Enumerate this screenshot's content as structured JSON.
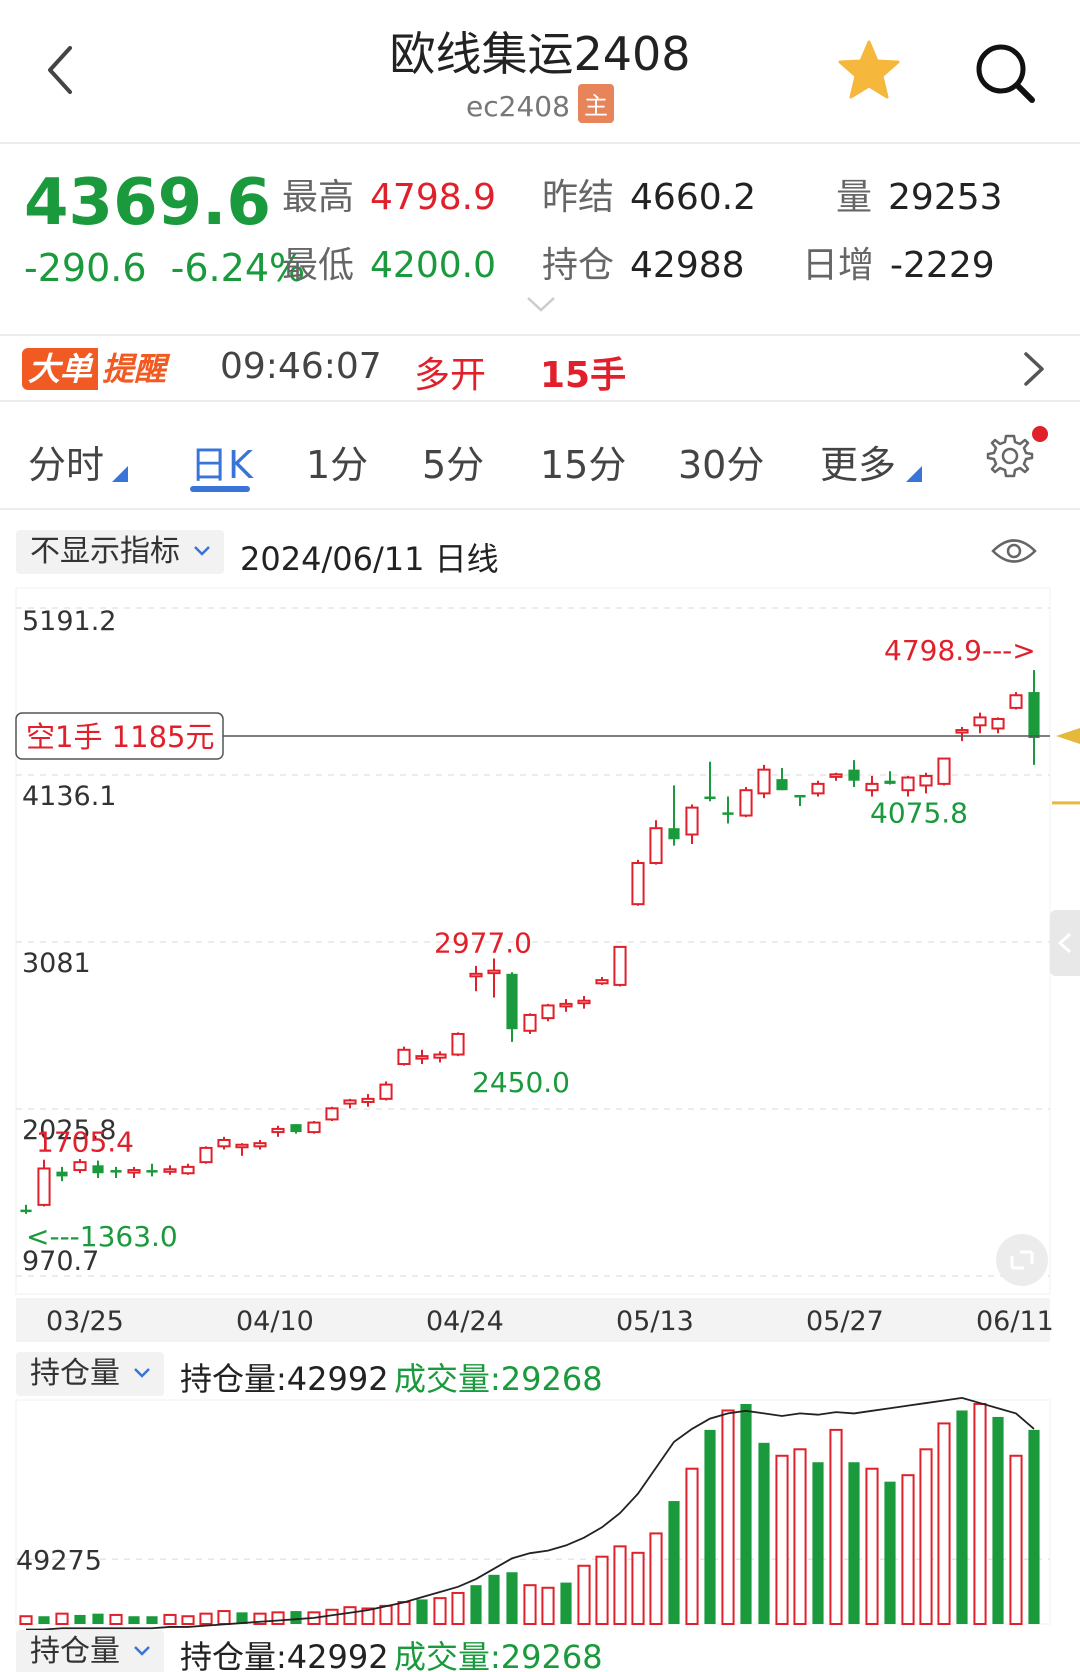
{
  "header": {
    "title": "欧线集运2408",
    "code": "ec2408",
    "badge": "主"
  },
  "quote": {
    "price": "4369.6",
    "change": "-290.6",
    "change_pct": "-6.24%",
    "high_label": "最高",
    "high": "4798.9",
    "low_label": "最低",
    "low": "4200.0",
    "prev_settle_label": "昨结",
    "prev_settle": "4660.2",
    "open_interest_label": "持仓",
    "open_interest": "42988",
    "volume_label": "量",
    "volume": "29253",
    "daily_inc_label": "日增",
    "daily_inc": "-2229"
  },
  "alert": {
    "logo_a": "大单",
    "logo_b": "提醒",
    "time": "09:46:07",
    "action": "多开",
    "lots": "15手"
  },
  "tabs": [
    {
      "label": "分时",
      "active": false
    },
    {
      "label": "日K",
      "active": true
    },
    {
      "label": "1分",
      "active": false
    },
    {
      "label": "5分",
      "active": false
    },
    {
      "label": "15分",
      "active": false
    },
    {
      "label": "30分",
      "active": false
    },
    {
      "label": "更多",
      "active": false
    }
  ],
  "indicator": {
    "select": "不显示指标",
    "date_text": "2024/06/11  日线"
  },
  "volume_panel": {
    "select": "持仓量",
    "oi_text": "持仓量:42992",
    "vol_text": "成交量:29268"
  },
  "colors": {
    "up": "#e0202b",
    "down": "#1a9a3c",
    "accent": "#3a74d8"
  },
  "chart_data": {
    "type": "candlestick",
    "y_ticks": [
      "5191.2",
      "4136.1",
      "3081",
      "2025.8",
      "970.7"
    ],
    "ylim": [
      970.7,
      5191.2
    ],
    "x_ticks": [
      "03/25",
      "04/10",
      "04/24",
      "05/13",
      "05/27",
      "06/11"
    ],
    "position_label": "空1手  1185元",
    "position_price": 4369.6,
    "annotations": [
      {
        "text": "4798.9",
        "price": 4798.9,
        "color": "up",
        "arrow": "right"
      },
      {
        "text": "1705.4",
        "price": 1705.4,
        "color": "up",
        "arrow": "none"
      },
      {
        "text": "1363.0",
        "price": 1363.0,
        "color": "down",
        "arrow": "left"
      },
      {
        "text": "2977.0",
        "price": 2977.0,
        "color": "up",
        "arrow": "none"
      },
      {
        "text": "2450.0",
        "price": 2450.0,
        "color": "down",
        "arrow": "none"
      },
      {
        "text": "4075.8",
        "price": 4075.8,
        "color": "down",
        "arrow": "none"
      }
    ],
    "candles": [
      {
        "o": 1390,
        "h": 1420,
        "l": 1363,
        "c": 1375
      },
      {
        "o": 1420,
        "h": 1705.4,
        "l": 1410,
        "c": 1650
      },
      {
        "o": 1630,
        "h": 1660,
        "l": 1570,
        "c": 1600
      },
      {
        "o": 1640,
        "h": 1710,
        "l": 1620,
        "c": 1690
      },
      {
        "o": 1670,
        "h": 1700,
        "l": 1590,
        "c": 1620
      },
      {
        "o": 1640,
        "h": 1660,
        "l": 1590,
        "c": 1630
      },
      {
        "o": 1625,
        "h": 1660,
        "l": 1590,
        "c": 1640
      },
      {
        "o": 1640,
        "h": 1680,
        "l": 1600,
        "c": 1630
      },
      {
        "o": 1630,
        "h": 1670,
        "l": 1610,
        "c": 1645
      },
      {
        "o": 1620,
        "h": 1680,
        "l": 1610,
        "c": 1660
      },
      {
        "o": 1690,
        "h": 1790,
        "l": 1680,
        "c": 1780
      },
      {
        "o": 1790,
        "h": 1850,
        "l": 1770,
        "c": 1830
      },
      {
        "o": 1800,
        "h": 1810,
        "l": 1730,
        "c": 1800
      },
      {
        "o": 1790,
        "h": 1830,
        "l": 1770,
        "c": 1810
      },
      {
        "o": 1880,
        "h": 1920,
        "l": 1850,
        "c": 1900
      },
      {
        "o": 1930,
        "h": 1930,
        "l": 1870,
        "c": 1880
      },
      {
        "o": 1880,
        "h": 1950,
        "l": 1870,
        "c": 1940
      },
      {
        "o": 1960,
        "h": 2040,
        "l": 1950,
        "c": 2030
      },
      {
        "o": 2060,
        "h": 2090,
        "l": 2030,
        "c": 2080
      },
      {
        "o": 2070,
        "h": 2120,
        "l": 2040,
        "c": 2090
      },
      {
        "o": 2090,
        "h": 2200,
        "l": 2080,
        "c": 2180
      },
      {
        "o": 2310,
        "h": 2420,
        "l": 2300,
        "c": 2400
      },
      {
        "o": 2360,
        "h": 2400,
        "l": 2310,
        "c": 2360
      },
      {
        "o": 2350,
        "h": 2390,
        "l": 2320,
        "c": 2370
      },
      {
        "o": 2370,
        "h": 2510,
        "l": 2360,
        "c": 2500
      },
      {
        "o": 2880,
        "h": 2930,
        "l": 2770,
        "c": 2880
      },
      {
        "o": 2900,
        "h": 2977,
        "l": 2730,
        "c": 2900
      },
      {
        "o": 2880,
        "h": 2890,
        "l": 2450,
        "c": 2530
      },
      {
        "o": 2520,
        "h": 2630,
        "l": 2500,
        "c": 2620
      },
      {
        "o": 2600,
        "h": 2690,
        "l": 2580,
        "c": 2680
      },
      {
        "o": 2690,
        "h": 2720,
        "l": 2640,
        "c": 2690
      },
      {
        "o": 2700,
        "h": 2740,
        "l": 2660,
        "c": 2710
      },
      {
        "o": 2820,
        "h": 2860,
        "l": 2810,
        "c": 2840
      },
      {
        "o": 2810,
        "h": 3050,
        "l": 2800,
        "c": 3050
      },
      {
        "o": 3320,
        "h": 3600,
        "l": 3310,
        "c": 3580
      },
      {
        "o": 3580,
        "h": 3850,
        "l": 3570,
        "c": 3800
      },
      {
        "o": 3800,
        "h": 4070,
        "l": 3690,
        "c": 3730
      },
      {
        "o": 3760,
        "h": 3950,
        "l": 3700,
        "c": 3930
      },
      {
        "o": 4000,
        "h": 4220,
        "l": 3970,
        "c": 3990
      },
      {
        "o": 3900,
        "h": 4000,
        "l": 3830,
        "c": 3890
      },
      {
        "o": 3880,
        "h": 4060,
        "l": 3870,
        "c": 4040
      },
      {
        "o": 4020,
        "h": 4200,
        "l": 3990,
        "c": 4170
      },
      {
        "o": 4110,
        "h": 4180,
        "l": 4040,
        "c": 4040
      },
      {
        "o": 4010,
        "h": 4010,
        "l": 3940,
        "c": 4000
      },
      {
        "o": 4020,
        "h": 4100,
        "l": 4000,
        "c": 4080
      },
      {
        "o": 4130,
        "h": 4150,
        "l": 4100,
        "c": 4140
      },
      {
        "o": 4170,
        "h": 4230,
        "l": 4060,
        "c": 4100
      },
      {
        "o": 4040,
        "h": 4130,
        "l": 4000,
        "c": 4080
      },
      {
        "o": 4100,
        "h": 4160,
        "l": 4075.8,
        "c": 4080
      },
      {
        "o": 4040,
        "h": 4130,
        "l": 4000,
        "c": 4120
      },
      {
        "o": 4070,
        "h": 4150,
        "l": 4020,
        "c": 4130
      },
      {
        "o": 4080,
        "h": 4240,
        "l": 4070,
        "c": 4240
      },
      {
        "o": 4420,
        "h": 4440,
        "l": 4350,
        "c": 4420
      },
      {
        "o": 4450,
        "h": 4530,
        "l": 4400,
        "c": 4500
      },
      {
        "o": 4430,
        "h": 4500,
        "l": 4400,
        "c": 4490
      },
      {
        "o": 4560,
        "h": 4660,
        "l": 4550,
        "c": 4640
      },
      {
        "o": 4660.2,
        "h": 4798.9,
        "l": 4200,
        "c": 4369.6
      }
    ],
    "volume_ticks": [
      "49275"
    ],
    "volumes": [
      6,
      6,
      8,
      7,
      8,
      7,
      6,
      6,
      7,
      6,
      8,
      10,
      9,
      8,
      9,
      10,
      9,
      11,
      13,
      12,
      14,
      17,
      19,
      20,
      24,
      30,
      38,
      40,
      30,
      28,
      32,
      45,
      52,
      60,
      55,
      70,
      95,
      120,
      150,
      165,
      170,
      140,
      130,
      135,
      125,
      150,
      125,
      120,
      110,
      115,
      135,
      155,
      165,
      170,
      160,
      130,
      150
    ],
    "volume_colors": [
      "u",
      "d",
      "u",
      "d",
      "d",
      "u",
      "d",
      "d",
      "u",
      "u",
      "u",
      "u",
      "d",
      "u",
      "u",
      "d",
      "u",
      "u",
      "u",
      "u",
      "u",
      "u",
      "d",
      "u",
      "u",
      "d",
      "d",
      "d",
      "u",
      "u",
      "d",
      "u",
      "u",
      "u",
      "u",
      "u",
      "d",
      "u",
      "d",
      "u",
      "d",
      "d",
      "u",
      "u",
      "d",
      "u",
      "d",
      "u",
      "d",
      "u",
      "u",
      "u",
      "d",
      "u",
      "d",
      "u",
      "d"
    ],
    "open_interest_line": [
      5,
      5,
      6,
      6,
      6,
      6,
      6,
      6,
      7,
      7,
      8,
      9,
      10,
      11,
      12,
      13,
      14,
      16,
      18,
      20,
      23,
      26,
      30,
      34,
      38,
      44,
      52,
      60,
      64,
      66,
      70,
      76,
      84,
      95,
      110,
      130,
      150,
      160,
      168,
      172,
      174,
      172,
      170,
      172,
      171,
      173,
      172,
      174,
      176,
      178,
      180,
      182,
      184,
      180,
      176,
      172,
      160
    ]
  }
}
